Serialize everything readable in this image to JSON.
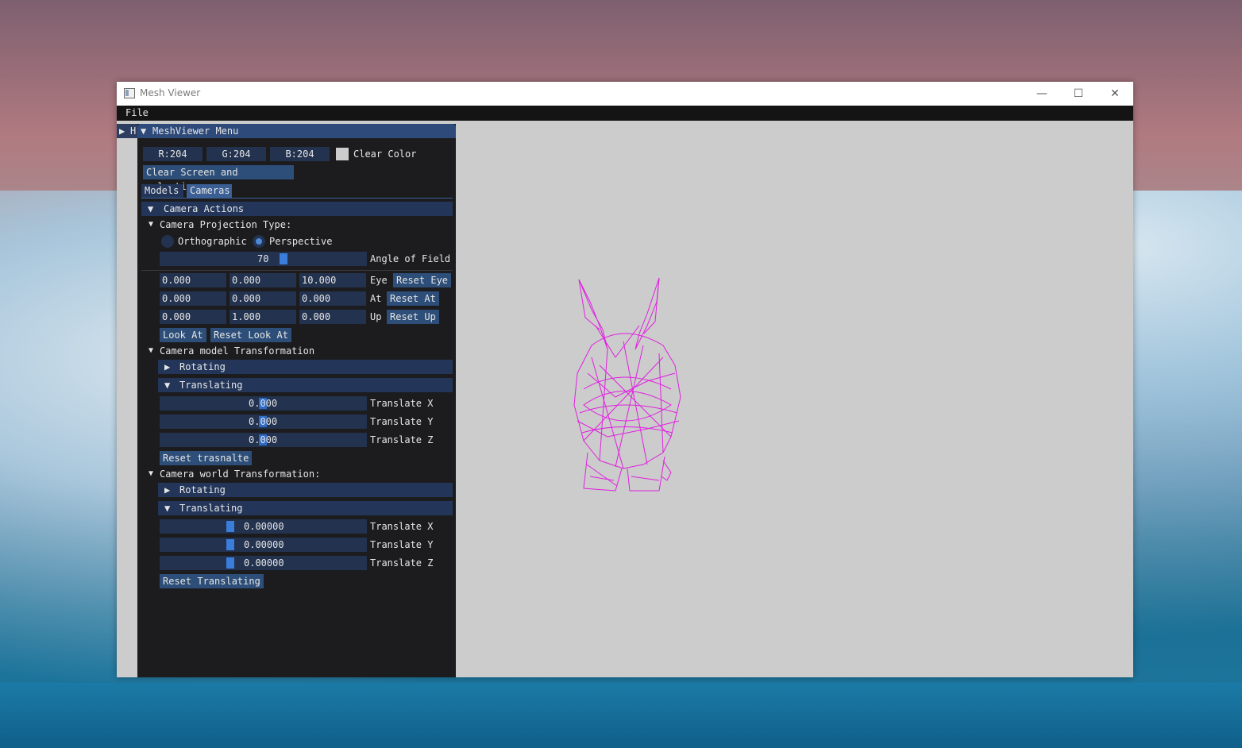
{
  "window": {
    "title": "Mesh Viewer",
    "minimize": "—",
    "maximize": "☐",
    "close": "✕"
  },
  "menu": {
    "file": "File"
  },
  "collapsed_window": {
    "arrow": "▶",
    "label": "H"
  },
  "panel": {
    "arrow": "▼",
    "title": "MeshViewer Menu",
    "clear_color": {
      "r": "R:204",
      "g": "G:204",
      "b": "B:204",
      "label": "Clear Color",
      "swatch": "#cccccc"
    },
    "clear_button": "Clear Screen and selection",
    "tabs": [
      "Models",
      "Cameras"
    ],
    "camera_actions": "Camera Actions",
    "projection": {
      "title": "Camera Projection Type:",
      "orthographic": "Orthographic",
      "perspective": "Perspective",
      "angle_value": "70",
      "angle_label": "Angle of Field"
    },
    "lookat": {
      "eye": [
        "0.000",
        "0.000",
        "10.000"
      ],
      "eye_label": "Eye",
      "reset_eye": "Reset Eye",
      "at": [
        "0.000",
        "0.000",
        "0.000"
      ],
      "at_label": "At",
      "reset_at": "Reset At",
      "up": [
        "0.000",
        "1.000",
        "0.000"
      ],
      "up_label": "Up",
      "reset_up": "Reset Up",
      "look_at": "Look At",
      "reset_look_at": "Reset Look At"
    },
    "model_transform": {
      "title": "Camera model Transformation",
      "rotating": "Rotating",
      "translating": "Translating",
      "x": "0.000",
      "y": "0.000",
      "z": "0.000",
      "x_label": "Translate X",
      "y_label": "Translate Y",
      "z_label": "Translate Z",
      "reset": "Reset trasnalte"
    },
    "world_transform": {
      "title": "Camera world Transformation:",
      "rotating": "Rotating",
      "translating": "Translating",
      "x": "0.00000",
      "y": "0.00000",
      "z": "0.00000",
      "x_label": "Translate X",
      "y_label": "Translate Y",
      "z_label": "Translate Z",
      "reset": "Reset Translating"
    }
  },
  "colors": {
    "mesh": "#e020e0",
    "accent": "#3b7ddb"
  }
}
